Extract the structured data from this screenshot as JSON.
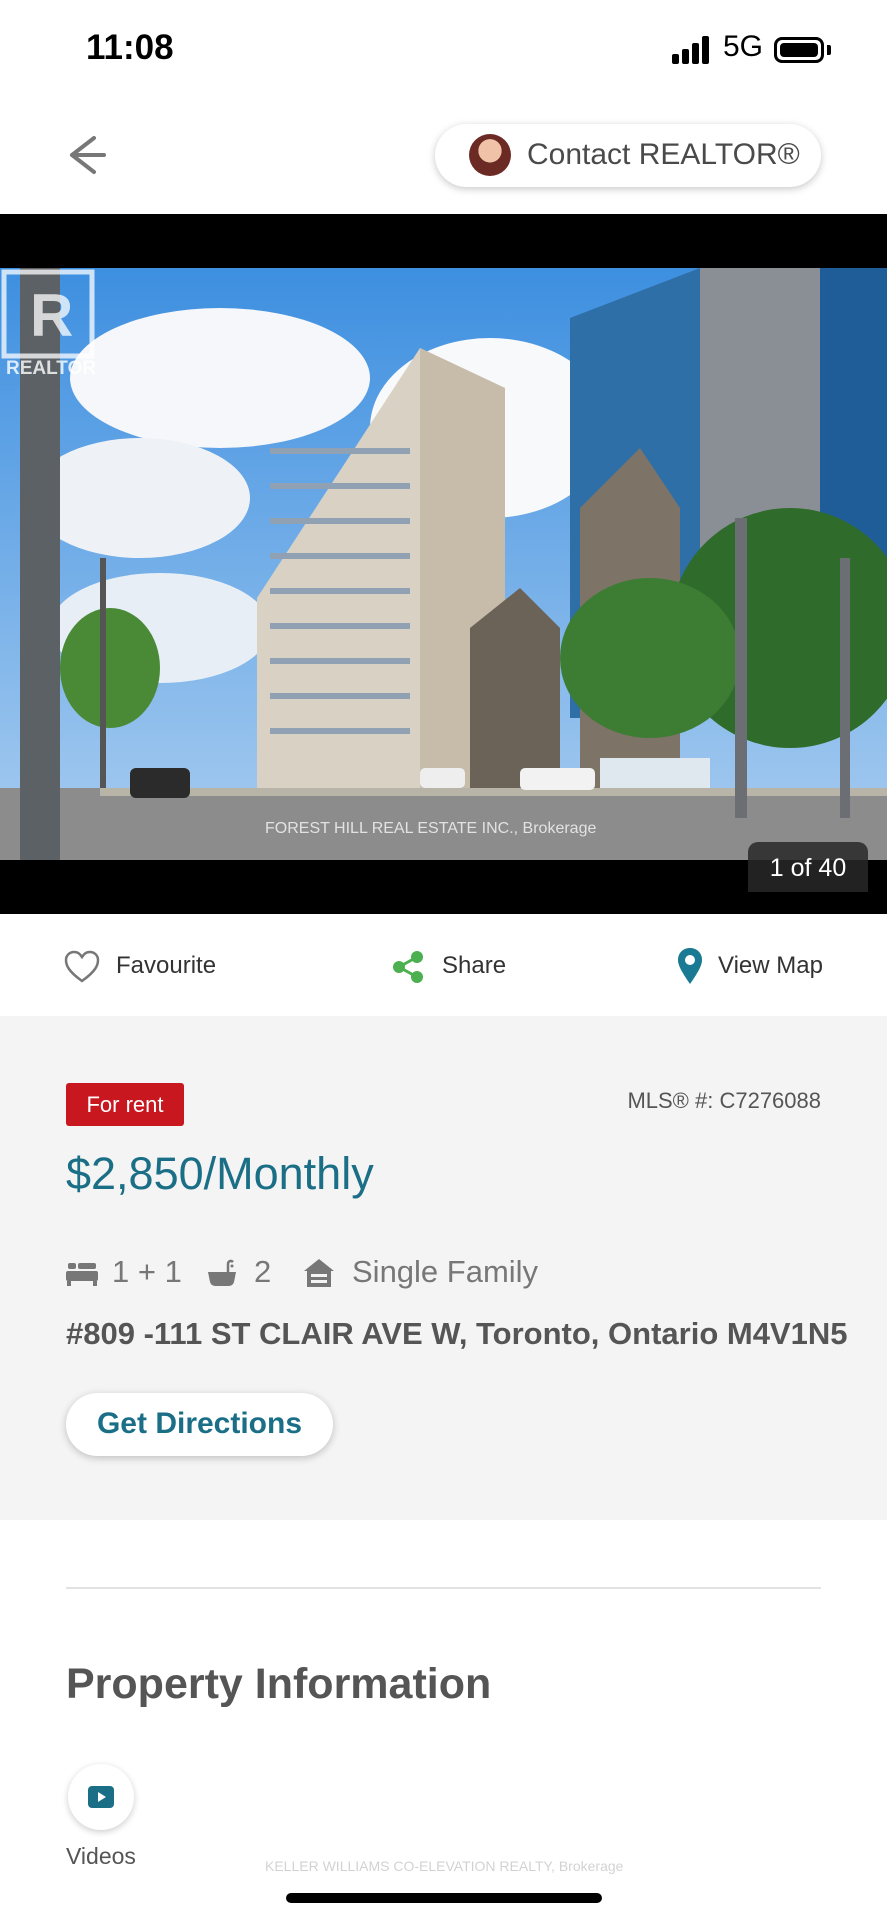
{
  "status_bar": {
    "time": "11:08",
    "network": "5G",
    "icons": [
      "signal-icon",
      "battery-icon"
    ]
  },
  "header": {
    "back_icon": "back-arrow-icon",
    "contact_label": "Contact REALTOR®"
  },
  "photo": {
    "watermark": "FOREST HILL REAL ESTATE INC., Brokerage",
    "logo_text": "REALTOR",
    "counter": "1 of 40"
  },
  "actions": {
    "favourite": "Favourite",
    "share": "Share",
    "view_map": "View Map",
    "icons": [
      "heart-icon",
      "share-icon",
      "map-pin-icon"
    ]
  },
  "listing": {
    "status_badge": "For rent",
    "mls": "MLS® #: C7276088",
    "price": "$2,850/Monthly",
    "bedrooms": "1 + 1",
    "bathrooms": "2",
    "property_type": "Single Family",
    "address": "#809 -111 ST CLAIR AVE W, Toronto, Ontario M4V1N5",
    "directions_label": "Get Directions",
    "icons": [
      "bed-icon",
      "bath-icon",
      "house-icon"
    ]
  },
  "property_info": {
    "title": "Property Information",
    "videos_label": "Videos",
    "footer_brokerage": "KELLER WILLIAMS CO-ELEVATION REALTY, Brokerage"
  },
  "colors": {
    "accent": "#1a6e86",
    "badge": "#c8171e",
    "share_green": "#4caf50",
    "map_pin": "#1a7a94"
  }
}
